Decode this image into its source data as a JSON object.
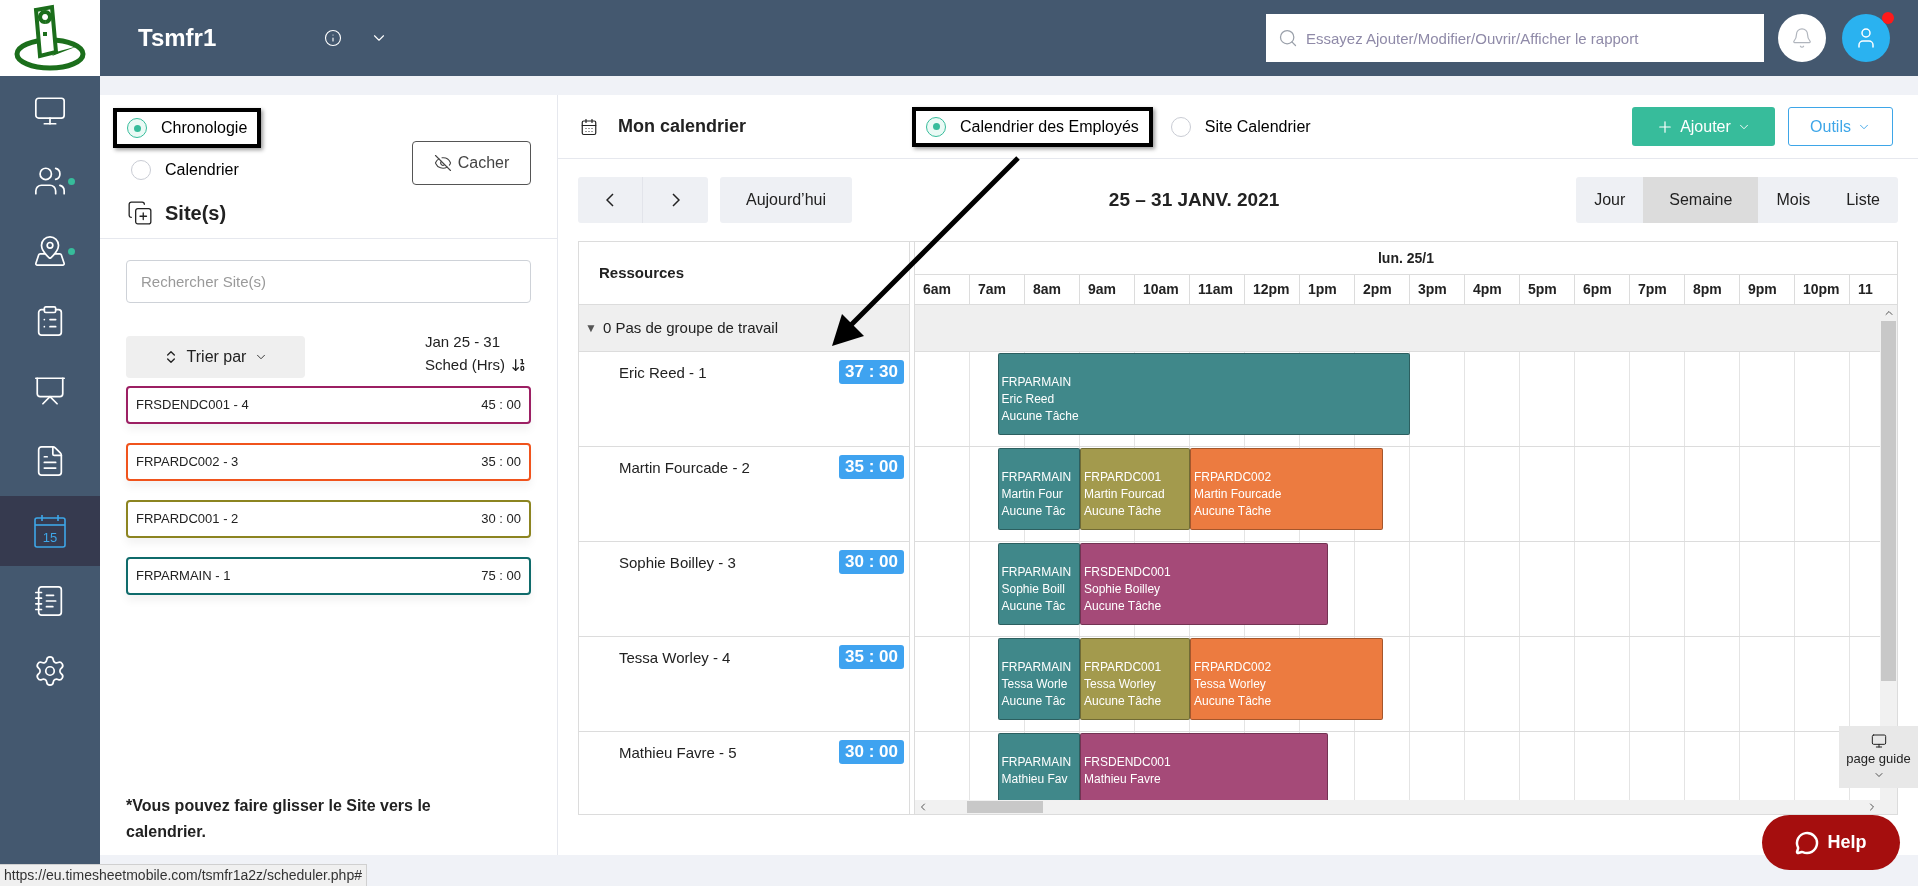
{
  "app": {
    "title": "Tsmfr1"
  },
  "search": {
    "placeholder": "Essayez Ajouter/Modifier/Ouvrir/Afficher le rapport"
  },
  "nav": [
    {
      "kind": "monitor",
      "selected": false,
      "dot": false
    },
    {
      "kind": "users",
      "selected": false,
      "dot": true
    },
    {
      "kind": "map",
      "selected": false,
      "dot": true
    },
    {
      "kind": "clipboard",
      "selected": false,
      "dot": false
    },
    {
      "kind": "presentation",
      "selected": false,
      "dot": false
    },
    {
      "kind": "document",
      "selected": false,
      "dot": false
    },
    {
      "kind": "calendar",
      "selected": true,
      "dot": false,
      "label": "15"
    },
    {
      "kind": "book",
      "selected": false,
      "dot": false
    },
    {
      "kind": "settings",
      "selected": false,
      "dot": false
    }
  ],
  "left": {
    "view_modes": [
      {
        "label": "Chronologie",
        "selected": true,
        "highlighted": true
      },
      {
        "label": "Calendrier",
        "selected": false,
        "highlighted": false
      }
    ],
    "hide_button": "Cacher",
    "sites_title": "Site(s)",
    "site_search": {
      "placeholder": "Rechercher Site(s)"
    },
    "sort_button": "Trier par",
    "period": "Jan 25 - 31",
    "sched_label": "Sched (Hrs)",
    "sites": [
      {
        "name": "FRSDENDC001 - 4",
        "hours": "45 : 00",
        "color": "#9c1f63"
      },
      {
        "name": "FRPARDC002 - 3",
        "hours": "35 : 00",
        "color": "#f0531c"
      },
      {
        "name": "FRPARDC001 - 2",
        "hours": "30 : 00",
        "color": "#8c8420"
      },
      {
        "name": "FRPARMAIN - 1",
        "hours": "75 : 00",
        "color": "#0f6b6b"
      }
    ],
    "note": "*Vous pouvez faire glisser le Site vers le calendrier."
  },
  "calendar": {
    "title": "Mon calendrier",
    "modes": [
      {
        "label": "Calendrier des Employés",
        "selected": true,
        "highlighted": true
      },
      {
        "label": "Site Calendrier",
        "selected": false,
        "highlighted": false
      }
    ],
    "add_button": "Ajouter",
    "tools_button": "Outils",
    "today_button": "Aujourd’hui",
    "range": "25 – 31 JANV. 2021",
    "views": [
      {
        "label": "Jour",
        "selected": false
      },
      {
        "label": "Semaine",
        "selected": true
      },
      {
        "label": "Mois",
        "selected": false
      },
      {
        "label": "Liste",
        "selected": false
      }
    ],
    "resources_header": "Ressources",
    "day_header": "lun. 25/1",
    "hours": [
      "6am",
      "7am",
      "8am",
      "9am",
      "10am",
      "11am",
      "12pm",
      "1pm",
      "2pm",
      "3pm",
      "4pm",
      "5pm",
      "6pm",
      "7pm",
      "8pm",
      "9pm",
      "10pm",
      "11"
    ],
    "group": {
      "toggle": "▼",
      "label": "0 Pas de groupe de travail"
    },
    "employees": [
      {
        "name": "Eric Reed - 1",
        "hours": "37 : 30",
        "events": [
          {
            "site": "FRPARMAIN",
            "employee": "Eric Reed",
            "task": "Aucune Tâche",
            "color": "#40888a"
          }
        ]
      },
      {
        "name": "Martin Fourcade - 2",
        "hours": "35 : 00",
        "events": [
          {
            "site": "FRPARMAIN",
            "employee": "Martin Four",
            "task": "Aucune Tâc",
            "color": "#40888a"
          },
          {
            "site": "FRPARDC001",
            "employee": "Martin Fourcad",
            "task": "Aucune Tâche",
            "color": "#a39a4d"
          },
          {
            "site": "FRPARDC002",
            "employee": "Martin Fourcade",
            "task": "Aucune Tâche",
            "color": "#ec7b40"
          }
        ]
      },
      {
        "name": "Sophie Boilley - 3",
        "hours": "30 : 00",
        "events": [
          {
            "site": "FRPARMAIN",
            "employee": "Sophie Boill",
            "task": "Aucune Tâc",
            "color": "#40888a"
          },
          {
            "site": "FRSDENDC001",
            "employee": "Sophie Boilley",
            "task": "Aucune Tâche",
            "color": "#a54a78"
          }
        ]
      },
      {
        "name": "Tessa Worley - 4",
        "hours": "35 : 00",
        "events": [
          {
            "site": "FRPARMAIN",
            "employee": "Tessa Worle",
            "task": "Aucune Tâc",
            "color": "#40888a"
          },
          {
            "site": "FRPARDC001",
            "employee": "Tessa Worley",
            "task": "Aucune Tâche",
            "color": "#a39a4d"
          },
          {
            "site": "FRPARDC002",
            "employee": "Tessa Worley",
            "task": "Aucune Tâche",
            "color": "#ec7b40"
          }
        ]
      },
      {
        "name": "Mathieu Favre - 5",
        "hours": "30 : 00",
        "events": [
          {
            "site": "FRPARMAIN",
            "employee": "Mathieu Fav",
            "color": "#40888a"
          },
          {
            "site": "FRSDENDC001",
            "employee": "Mathieu Favre",
            "color": "#a54a78"
          }
        ]
      }
    ]
  },
  "page_guide": "page guide",
  "help_button": "Help",
  "status_url": "https://eu.timesheetmobile.com/tsmfr1a2z/scheduler.php#"
}
